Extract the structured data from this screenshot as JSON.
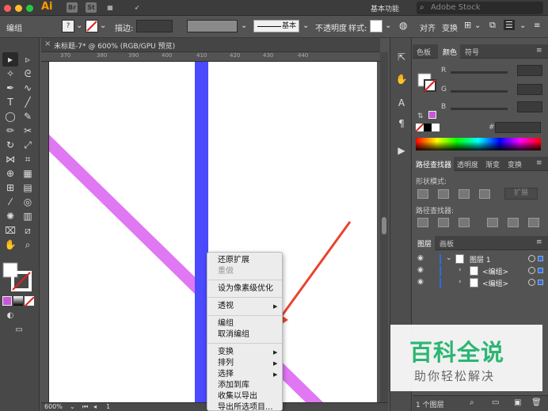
{
  "menubar": {
    "app_logo": "Ai",
    "app_icons": [
      "Br",
      "St"
    ],
    "workspace": "基本功能",
    "search_placeholder": "Adobe Stock"
  },
  "controlbar": {
    "selection_label": "编组",
    "stroke_label": "描边:",
    "stroke_style": "基本",
    "opacity_label": "不透明度",
    "style_label": "样式:",
    "align_label": "对齐",
    "transform_label": "变换"
  },
  "document": {
    "tab_title": "未标题-7* @ 600% (RGB/GPU 预览)",
    "ruler_ticks": [
      "370",
      "380",
      "390",
      "400",
      "410",
      "420",
      "430",
      "440"
    ],
    "zoom": "600%",
    "page_number": "1"
  },
  "context_menu": {
    "items": [
      "还原扩展",
      "重做",
      "设为像素级优化",
      "透视",
      "编组",
      "取消编组",
      "变换",
      "排列",
      "选择",
      "添加到库",
      "收集以导出",
      "导出所选项目..."
    ]
  },
  "color_panel": {
    "tabs": [
      "色板",
      "颜色",
      "符号"
    ],
    "channels": [
      "R",
      "G",
      "B"
    ],
    "hex_label": "#"
  },
  "pathfinder_panel": {
    "tabs": [
      "路径查找器",
      "透明度",
      "渐变",
      "变换"
    ],
    "shape_modes_label": "形状模式:",
    "expand_label": "扩展",
    "pathfinders_label": "路径查找器:"
  },
  "layers_panel": {
    "tabs": [
      "图层",
      "画板"
    ],
    "layers": [
      {
        "name": "图层 1",
        "level": 0
      },
      {
        "name": "<编组>",
        "level": 1
      },
      {
        "name": "<编组>",
        "level": 1
      }
    ],
    "count_label": "1 个图层"
  },
  "watermark": {
    "title": "百科全说",
    "subtitle": "助你轻松解决"
  },
  "colors": {
    "blue_stripe": "#4a4aff",
    "magenta_stripe": "#e077f3",
    "red_arrow": "#e8452f",
    "watermark_green": "#2bb673"
  }
}
